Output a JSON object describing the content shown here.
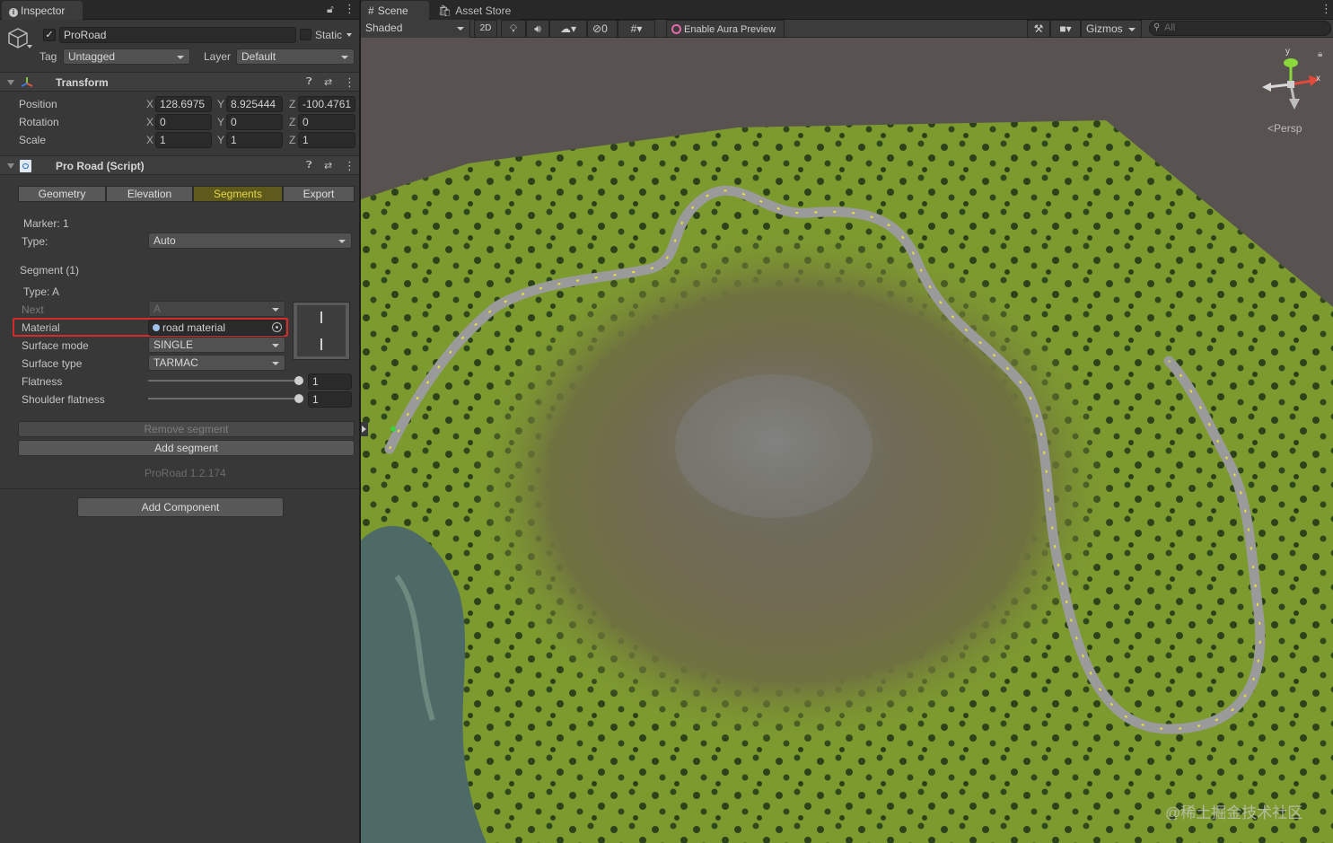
{
  "inspector": {
    "tab_label": "Inspector",
    "object": {
      "name": "ProRoad",
      "static_label": "Static",
      "tag_label": "Tag",
      "tag_value": "Untagged",
      "layer_label": "Layer",
      "layer_value": "Default"
    },
    "transform": {
      "title": "Transform",
      "position_label": "Position",
      "rotation_label": "Rotation",
      "scale_label": "Scale",
      "axis_x": "X",
      "axis_y": "Y",
      "axis_z": "Z",
      "position": {
        "x": "128.6975",
        "y": "8.925444",
        "z": "-100.4761"
      },
      "rotation": {
        "x": "0",
        "y": "0",
        "z": "0"
      },
      "scale": {
        "x": "1",
        "y": "1",
        "z": "1"
      }
    },
    "script": {
      "title": "Pro Road (Script)",
      "tabs": [
        "Geometry",
        "Elevation",
        "Segments",
        "Export"
      ],
      "active_tab": "Segments",
      "marker_label": "Marker: 1",
      "type_label": "Type:",
      "type_value": "Auto",
      "segment_label": "Segment (1)",
      "segment_type": "Type: A",
      "next_label": "Next",
      "next_value": "A",
      "material_label": "Material",
      "material_value": "road material",
      "surface_mode_label": "Surface mode",
      "surface_mode_value": "SINGLE",
      "surface_type_label": "Surface type",
      "surface_type_value": "TARMAC",
      "flatness_label": "Flatness",
      "flatness_value": "1",
      "shoulder_label": "Shoulder flatness",
      "shoulder_value": "1",
      "remove_segment": "Remove segment",
      "add_segment": "Add segment",
      "version": "ProRoad 1.2.174"
    },
    "add_component": "Add Component"
  },
  "scene": {
    "tabs": [
      "Scene",
      "Asset Store"
    ],
    "shading": "Shaded",
    "mode_2d": "2D",
    "hidden_count": "0",
    "aura": "Enable Aura Preview",
    "gizmos": "Gizmos",
    "search_placeholder": "All",
    "persp": "Persp",
    "gizmo_y": "y",
    "gizmo_x": "x",
    "watermark": "@稀土掘金技术社区"
  },
  "colors": {
    "highlight": "#d62b2b",
    "segment_active": "#e8d84a",
    "grass": "#7f9a2e"
  }
}
